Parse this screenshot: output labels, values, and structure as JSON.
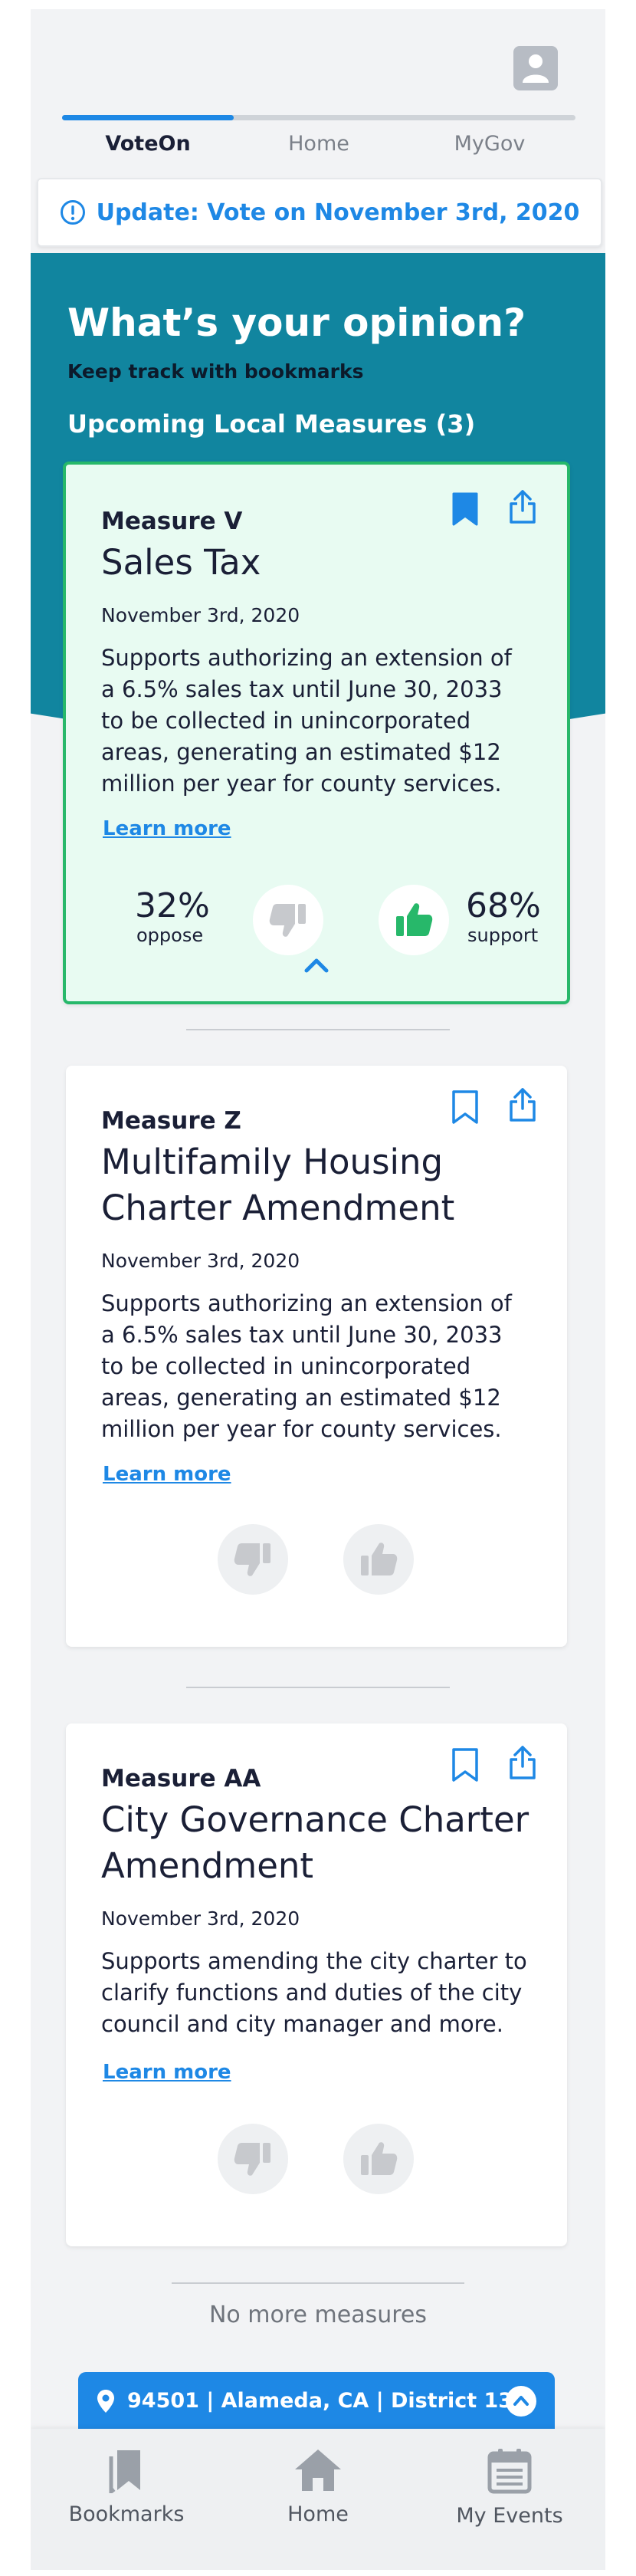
{
  "header": {
    "tabs": [
      {
        "label": "VoteOn",
        "active": true
      },
      {
        "label": "Home",
        "active": false
      },
      {
        "label": "MyGov",
        "active": false
      }
    ]
  },
  "banner": {
    "text": "Update: Vote on November 3rd, 2020"
  },
  "hero": {
    "title": "What’s your opinion?",
    "subtitle": "Keep track with bookmarks",
    "section_title": "Upcoming Local Measures (3)"
  },
  "measures": [
    {
      "label": "Measure V",
      "name": "Sales Tax",
      "date": "November 3rd, 2020",
      "description": "Supports authorizing an extension of a 6.5% sales tax until June 30, 2033 to be collected in unincorporated areas, generating an estimated $12 million per year for county services.",
      "learn_more": "Learn more",
      "bookmarked": true,
      "vote": "support",
      "oppose_pct": "32%",
      "oppose_label": "oppose",
      "support_pct": "68%",
      "support_label": "support"
    },
    {
      "label": "Measure Z",
      "name": "Multifamily Housing Charter Amendment",
      "date": "November 3rd, 2020",
      "description": "Supports authorizing an extension of a 6.5% sales tax until June 30, 2033 to be collected in unincorporated areas, generating an estimated $12 million per year for county services.",
      "learn_more": "Learn more",
      "bookmarked": false
    },
    {
      "label": "Measure AA",
      "name": "City Governance Charter Amendment",
      "date": "November 3rd, 2020",
      "description": "Supports amending the city charter to clarify functions and duties of the city council and city manager and more.",
      "learn_more": "Learn more",
      "bookmarked": false
    }
  ],
  "footer_note": "No more measures",
  "location": {
    "text": "94501 | Alameda, CA | District 13"
  },
  "bottom_nav": [
    {
      "label": "Bookmarks",
      "icon": "bookmarks-icon"
    },
    {
      "label": "Home",
      "icon": "home-icon"
    },
    {
      "label": "My Events",
      "icon": "calendar-icon"
    }
  ],
  "colors": {
    "accent": "#1e88e5",
    "hero": "#11859f",
    "support": "#27b86a",
    "featured_bg": "#e8fbf2"
  }
}
